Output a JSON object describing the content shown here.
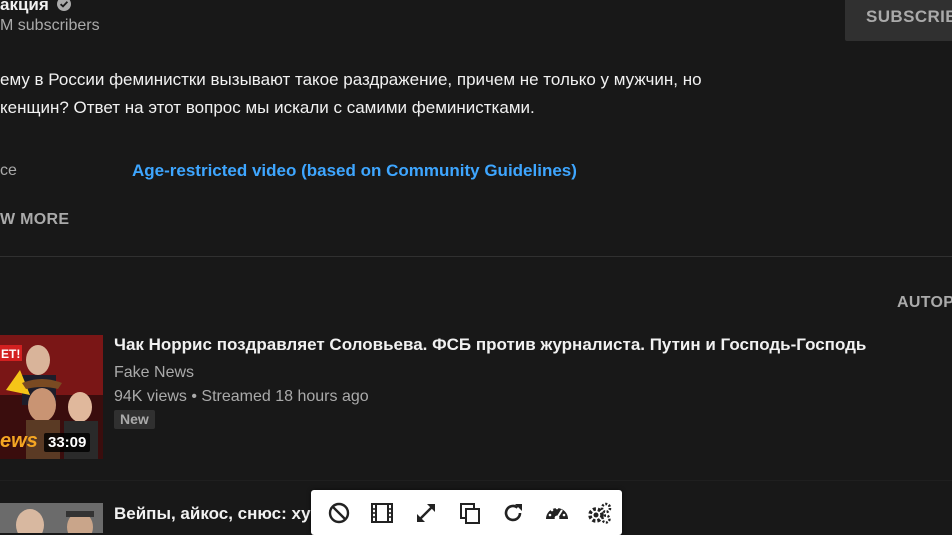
{
  "channel": {
    "name": "акция",
    "subscribers": "M subscribers",
    "subscribe_label": "SUBSCRIB",
    "verified_icon": "checkmark-circle-icon"
  },
  "description": {
    "line1": "ему в России феминистки вызывают такое раздражение, причем не только у мужчин, но",
    "line2": "кенщин? Ответ на этот вопрос мы искали с самими феминистками.",
    "meta_label": "ce",
    "meta_value": "Age-restricted video (based on Community Guidelines)",
    "show_more": "W MORE"
  },
  "up_next": {
    "autoplay_label": "AUTOP"
  },
  "videos": [
    {
      "title": "Чак Норрис поздравляет Соловьева. ФСБ против журналиста. Путин и Господь-Господь",
      "channel": "Fake News",
      "stats": "94K views • Streamed 18 hours ago",
      "badge": "New",
      "duration": "33:09",
      "thumbnail_text": "ET!"
    },
    {
      "title": "Вейпы, айкос, снюс: ху"
    }
  ],
  "toolbar": {
    "buttons": [
      {
        "icon": "block-icon"
      },
      {
        "icon": "film-strip-icon"
      },
      {
        "icon": "expand-icon"
      },
      {
        "icon": "copy-icon"
      },
      {
        "icon": "refresh-icon"
      },
      {
        "icon": "speedometer-icon"
      },
      {
        "icon": "settings-gears-icon"
      }
    ]
  },
  "colors": {
    "background": "#181818",
    "link": "#3ea6ff",
    "secondary_text": "#aaaaaa",
    "primary_text": "#f1f1f1"
  }
}
